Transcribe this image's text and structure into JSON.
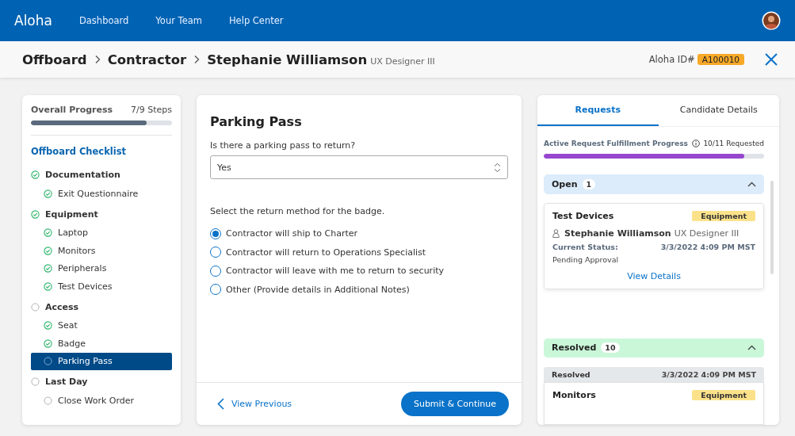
{
  "nav": {
    "logo": "Aloha",
    "links": [
      {
        "label": "Dashboard"
      },
      {
        "label": "Your Team"
      },
      {
        "label": "Help Center"
      }
    ]
  },
  "breadcrumb": {
    "items": [
      "Offboard",
      "Contractor",
      "Stephanie Williamson"
    ],
    "subtitle": "UX Designer III",
    "id_label": "Aloha ID#",
    "id_value": "A100010"
  },
  "progress": {
    "label": "Overall Progress",
    "reading": "7/9 Steps",
    "level": 0.82
  },
  "checklist": {
    "title": "Offboard Checklist",
    "items": [
      {
        "label": "Documentation",
        "done": true,
        "selected": false,
        "children": [
          {
            "label": "Exit Questionnaire",
            "done": true,
            "selected": false
          }
        ]
      },
      {
        "label": "Equipment",
        "done": true,
        "selected": false,
        "children": [
          {
            "label": "Laptop",
            "done": true,
            "selected": false
          },
          {
            "label": "Monitors",
            "done": true,
            "selected": false
          },
          {
            "label": "Peripherals",
            "done": true,
            "selected": false
          },
          {
            "label": "Test Devices",
            "done": true,
            "selected": false
          }
        ]
      },
      {
        "label": "Access",
        "done": false,
        "selected": false,
        "children": [
          {
            "label": "Seat",
            "done": true,
            "selected": false
          },
          {
            "label": "Badge",
            "done": true,
            "selected": false
          },
          {
            "label": "Parking Pass",
            "done": false,
            "selected": true
          }
        ]
      },
      {
        "label": "Last Day",
        "done": false,
        "selected": false,
        "children": [
          {
            "label": "Close Work Order",
            "done": false,
            "selected": false
          }
        ]
      }
    ]
  },
  "form": {
    "title": "Parking Pass",
    "question": "Is there a parking pass to return?",
    "select_value": "Yes",
    "method_label": "Select the return method for the badge.",
    "options": [
      {
        "label": "Contractor will ship to Charter",
        "selected": true
      },
      {
        "label": "Contractor will return to Operations Specialist",
        "selected": false
      },
      {
        "label": "Contractor will leave with me to return to security",
        "selected": false
      },
      {
        "label": "Other (Provide details in Additional Notes)",
        "selected": false
      }
    ],
    "previous": "View Previous",
    "submit": "Submit & Continue"
  },
  "requests": {
    "tabs": [
      {
        "label": "Requests",
        "selected": true
      },
      {
        "label": "Candidate Details",
        "selected": false
      }
    ],
    "progress": {
      "label": "Active Request Fulfillment Progress",
      "reading": "10/11 Requested",
      "level": 0.91
    },
    "groups": [
      {
        "label": "Open",
        "count": "1",
        "color": "#dcecfb",
        "expanded": true,
        "cards": [
          {
            "title": "Test Devices",
            "tag": "Equipment",
            "name": "Stephanie Williamson",
            "role": "UX Designer III",
            "status_label": "Current Status:",
            "date": "3/3/2022 4:09 PM MST",
            "status": "Pending Approval",
            "link": "View Details"
          }
        ]
      },
      {
        "label": "Resolved",
        "count": "10",
        "color": "#c9f7d8",
        "expanded": true,
        "cards": [
          {
            "title": "Monitors",
            "header": {
              "label": "Resolved",
              "date": "3/3/2022 4:09 PM MST"
            },
            "tag": "Equipment"
          }
        ]
      }
    ]
  }
}
